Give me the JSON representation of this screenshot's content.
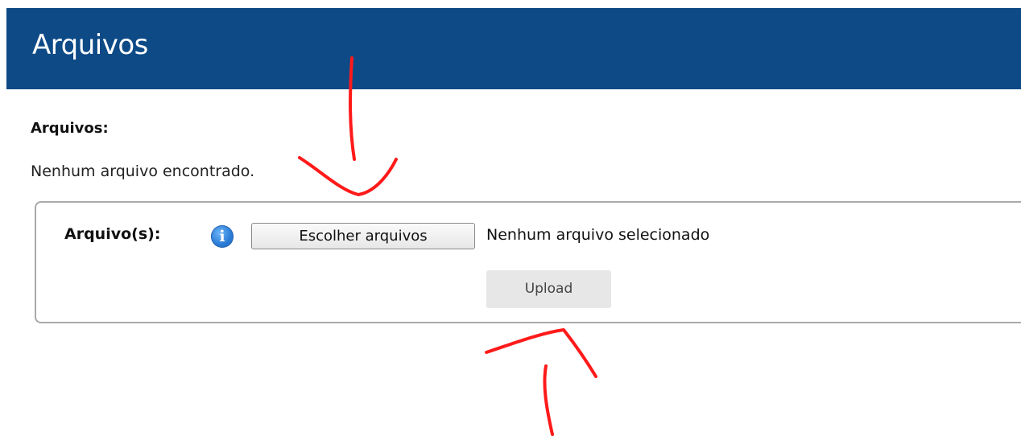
{
  "header": {
    "title": "Arquivos"
  },
  "files_section": {
    "label": "Arquivos:",
    "empty_message": "Nenhum arquivo encontrado."
  },
  "upload_form": {
    "field_label": "Arquivo(s):",
    "info_icon": "info-icon",
    "choose_button_label": "Escolher arquivos",
    "file_status": "Nenhum arquivo selecionado",
    "upload_button_label": "Upload"
  },
  "colors": {
    "header_bg": "#0d4a86",
    "annotation_stroke": "#ff1a1a",
    "upload_button_bg": "#e7e7e7"
  }
}
